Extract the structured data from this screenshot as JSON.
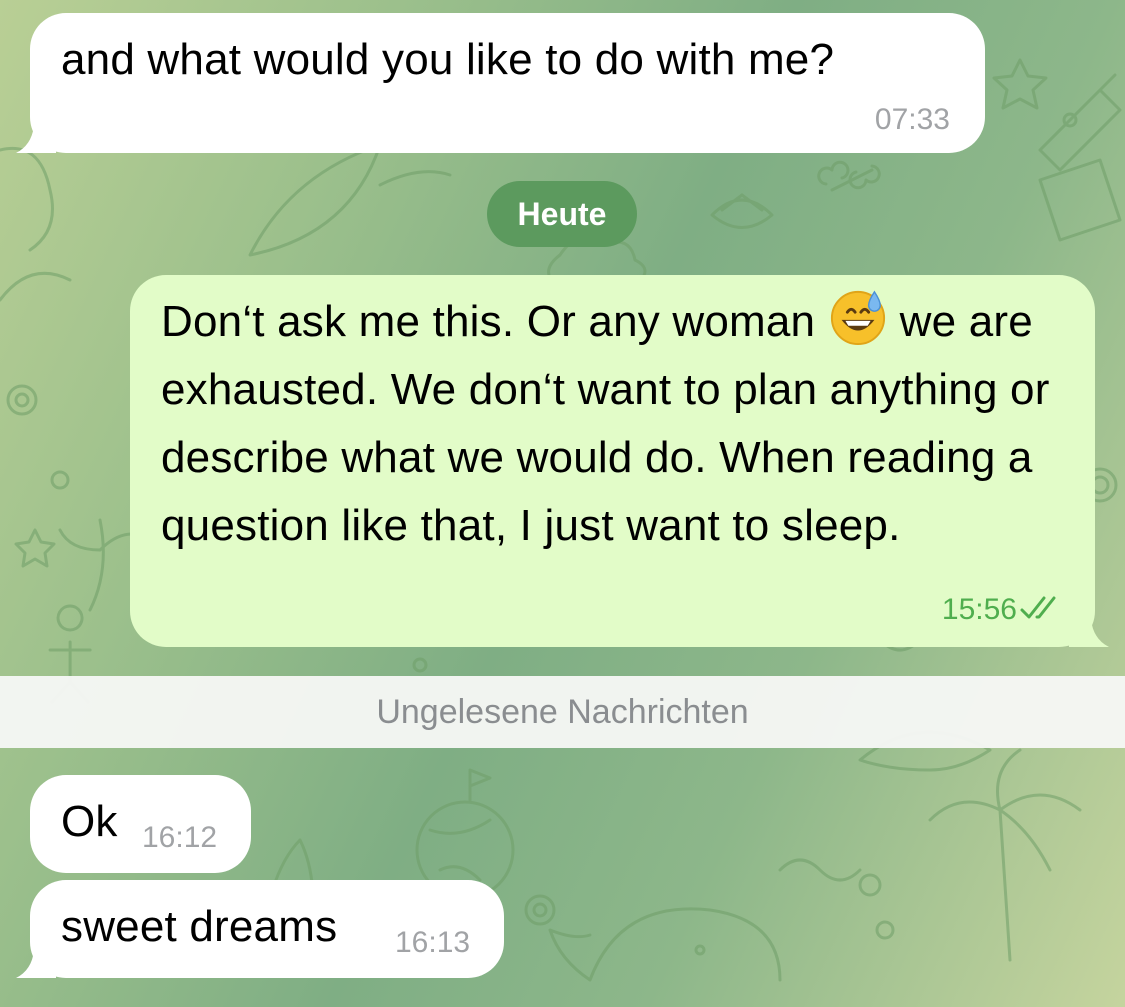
{
  "colors": {
    "incoming_bubble": "#ffffff",
    "outgoing_bubble": "#e2fcc8",
    "date_chip": "#5c9a5e",
    "outgoing_time": "#4fae4e",
    "incoming_time": "#a1a3a6"
  },
  "chat": {
    "messages": [
      {
        "direction": "incoming",
        "text": "and what would you like to do with me?",
        "time": "07:33"
      },
      {
        "direction": "outgoing",
        "text": "Don‘t ask me this. Or any woman",
        "emoji": "grinning-face-with-sweat",
        "text_cont": "we are exhausted. We don‘t want to plan anything or describe what we would do. When reading a question like that, I just want to sleep.",
        "time": "15:56",
        "status": "read"
      },
      {
        "direction": "incoming",
        "text": "Ok",
        "time": "16:12"
      },
      {
        "direction": "incoming",
        "text": "sweet dreams",
        "time": "16:13"
      }
    ],
    "date_separator": "Heute",
    "unread_separator": "Ungelesene Nachrichten"
  },
  "icons": {
    "read_receipt": "double-check-icon",
    "emoji": "grinning-face-with-sweat-icon"
  }
}
